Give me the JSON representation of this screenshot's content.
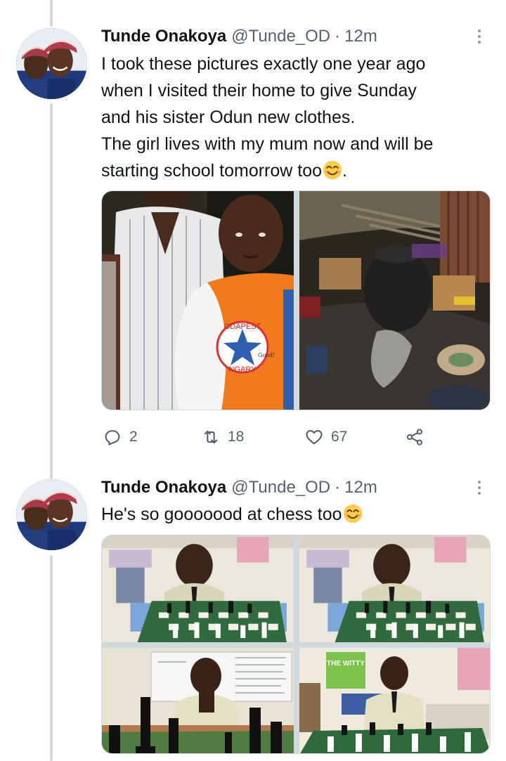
{
  "tweets": [
    {
      "author": {
        "name": "Tunde Onakoya",
        "handle": "@Tunde_OD",
        "separator": "·",
        "time": "12m"
      },
      "text_lines": [
        "I took these pictures exactly one year ago",
        "when I visited their home to give Sunday",
        "and his sister Odun new clothes.",
        "The girl lives with my mum now and will be",
        "starting school tomorrow too"
      ],
      "text_end": ".",
      "emoji": "smiling-face-emoji",
      "media": [
        {
          "name": "photo-boy-with-sister",
          "tshirt_text": "ODAPEST",
          "tshirt_text2": "NGARY",
          "tshirt_text3": "Good!"
        },
        {
          "name": "photo-home-interior"
        }
      ],
      "actions": {
        "reply_count": "2",
        "retweet_count": "18",
        "like_count": "67"
      }
    },
    {
      "author": {
        "name": "Tunde Onakoya",
        "handle": "@Tunde_OD",
        "separator": "·",
        "time": "12m"
      },
      "text_lines": [
        "He's so gooooood at chess too"
      ],
      "emoji": "smiling-face-emoji",
      "media": [
        {
          "name": "photo-chess-1"
        },
        {
          "name": "photo-chess-2"
        },
        {
          "name": "photo-chess-3"
        },
        {
          "name": "photo-chess-4",
          "board_text": "THE WITTY"
        }
      ]
    }
  ],
  "colors": {
    "accent": "#1d9bf0",
    "text": "#0f1419",
    "secondary": "#536471",
    "thread_line": "#cfd9de"
  },
  "icons": [
    "more-icon",
    "reply-icon",
    "retweet-icon",
    "like-icon",
    "share-icon"
  ]
}
